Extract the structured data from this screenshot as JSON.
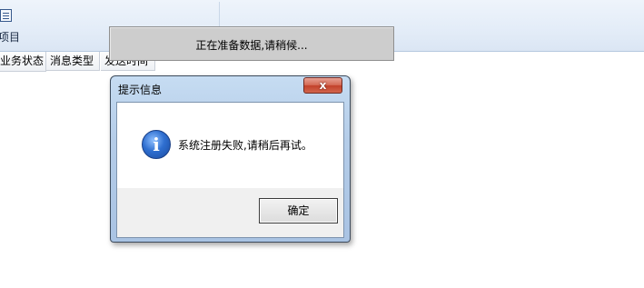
{
  "toolbar": {
    "button_label": "项目",
    "button_icon": "list-icon"
  },
  "grid": {
    "columns": [
      "业务状态",
      "消息类型",
      "发送时间"
    ]
  },
  "progress": {
    "text": "正在准备数据,请稍候..."
  },
  "dialog": {
    "title": "提示信息",
    "close_label": "x",
    "icon": "info-icon",
    "message": "系统注册失败,请稍后再试。",
    "ok_label": "确定"
  },
  "colors": {
    "ribbon_bg": "#e4edf8",
    "dialog_frame": "#b4cce8",
    "close_button": "#c2412a",
    "info_icon": "#2f6fd0"
  }
}
